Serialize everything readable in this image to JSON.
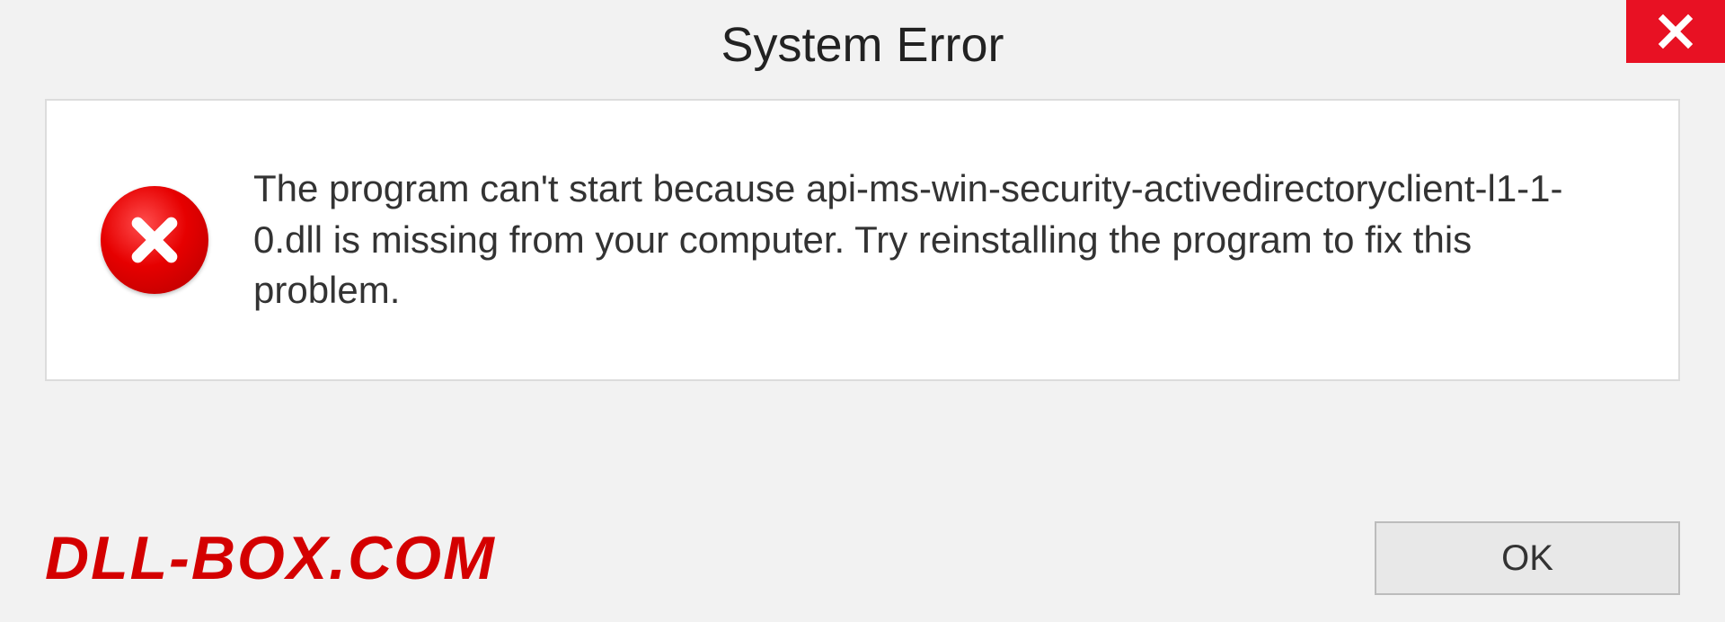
{
  "dialog": {
    "title": "System Error",
    "message": "The program can't start because api-ms-win-security-activedirectoryclient-l1-1-0.dll is missing from your computer. Try reinstalling the program to fix this problem.",
    "ok_label": "OK"
  },
  "watermark": "DLL-BOX.COM",
  "colors": {
    "close_bg": "#e81123",
    "error_red": "#d40000",
    "panel_bg": "#ffffff",
    "page_bg": "#f2f2f2"
  }
}
